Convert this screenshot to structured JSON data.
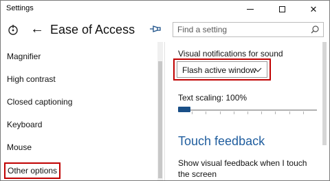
{
  "window": {
    "title": "Settings",
    "controls": {
      "minimize": "minimize",
      "maximize": "maximize",
      "close": "close"
    }
  },
  "header": {
    "home_icon": "home-icon",
    "back_icon": "back-arrow-icon",
    "title": "Ease of Access",
    "pin_icon": "pin-icon",
    "search_placeholder": "Find a setting",
    "search_value": "",
    "search_icon": "search-icon"
  },
  "sidebar": {
    "items": [
      {
        "label": "Magnifier"
      },
      {
        "label": "High contrast"
      },
      {
        "label": "Closed captioning"
      },
      {
        "label": "Keyboard"
      },
      {
        "label": "Mouse"
      },
      {
        "label": "Other options",
        "highlighted": true
      }
    ]
  },
  "content": {
    "visual_notifications": {
      "label": "Visual notifications for sound",
      "selected": "Flash active window"
    },
    "text_scaling": {
      "label": "Text scaling: 100%",
      "value_fraction": 0.0
    },
    "touch_feedback": {
      "title": "Touch feedback",
      "description": "Show visual feedback when I touch the screen"
    }
  },
  "colors": {
    "accent": "#1a4f87",
    "highlight_outline": "#c00000",
    "section_title": "#1f5d9e"
  }
}
